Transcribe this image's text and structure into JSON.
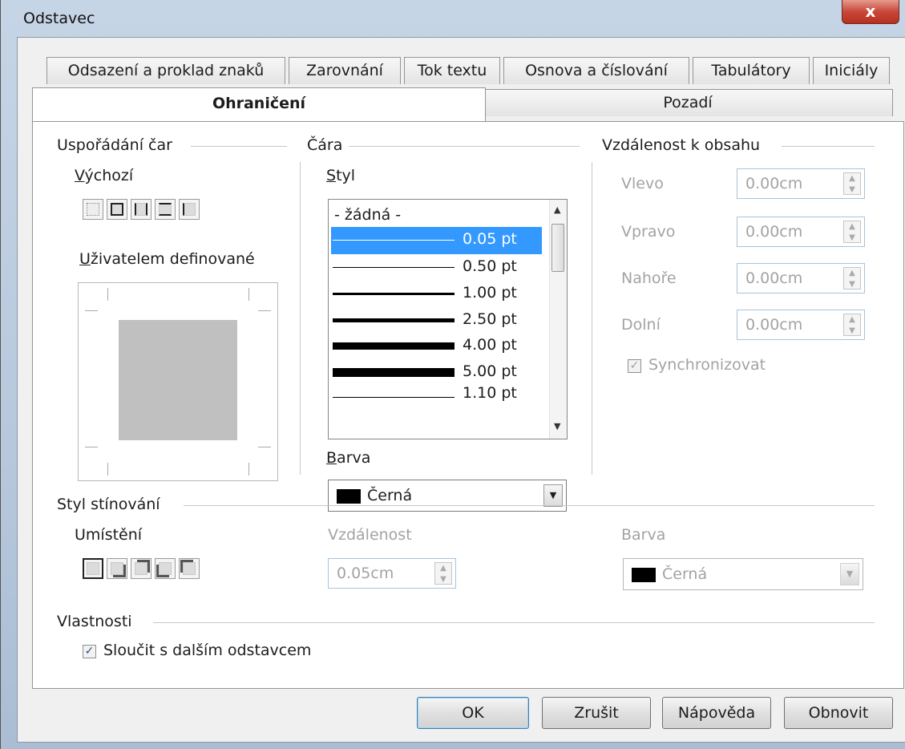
{
  "window": {
    "title": "Odstavec",
    "close_label": "x"
  },
  "tabs_row1": [
    {
      "label": "Odsazení a proklad znaků"
    },
    {
      "label": "Zarovnání"
    },
    {
      "label": "Tok textu"
    },
    {
      "label": "Osnova a číslování"
    },
    {
      "label": "Tabulátory"
    },
    {
      "label": "Iniciály"
    }
  ],
  "tabs_row2": [
    {
      "label": "Ohraničení",
      "selected": true
    },
    {
      "label": "Pozadí",
      "selected": false
    }
  ],
  "line_arrangement": {
    "heading": "Uspořádání čar",
    "default_label_pre": "",
    "default_label_u": "V",
    "default_label_post": "ýchozí",
    "user_defined_u": "U",
    "user_defined_post": "živatelem definované"
  },
  "line": {
    "heading": "Čára",
    "style_u": "S",
    "style_post": "tyl",
    "styles": [
      {
        "label": "- žádná -"
      },
      {
        "label": "0.05 pt",
        "selected": true
      },
      {
        "label": "0.50 pt"
      },
      {
        "label": "1.00 pt"
      },
      {
        "label": "2.50 pt"
      },
      {
        "label": "4.00 pt"
      },
      {
        "label": "5.00 pt"
      },
      {
        "label": "1.10 pt"
      }
    ],
    "color_u": "B",
    "color_post": "arva",
    "color_value": "Černá",
    "color_hex": "#000000"
  },
  "spacing": {
    "heading": "Vzdálenost k obsahu",
    "left_label": "Vlevo",
    "left_value": "0.00cm",
    "right_label": "Vpravo",
    "right_value": "0.00cm",
    "top_label": "Nahoře",
    "top_value": "0.00cm",
    "bottom_label": "Dolní",
    "bottom_value": "0.00cm",
    "sync_label": "Synchronizovat",
    "sync_checked": true
  },
  "shadow": {
    "heading": "Styl stínování",
    "position_label": "Umístění",
    "distance_label": "Vzdálenost",
    "distance_value": "0.05cm",
    "color_label": "Barva",
    "color_value": "Černá"
  },
  "properties": {
    "heading": "Vlastnosti",
    "merge_label": "Sloučit s dalším odstavcem",
    "merge_checked": true
  },
  "buttons": {
    "ok": "OK",
    "cancel": "Zrušit",
    "help": "Nápověda",
    "reset": "Obnovit"
  }
}
